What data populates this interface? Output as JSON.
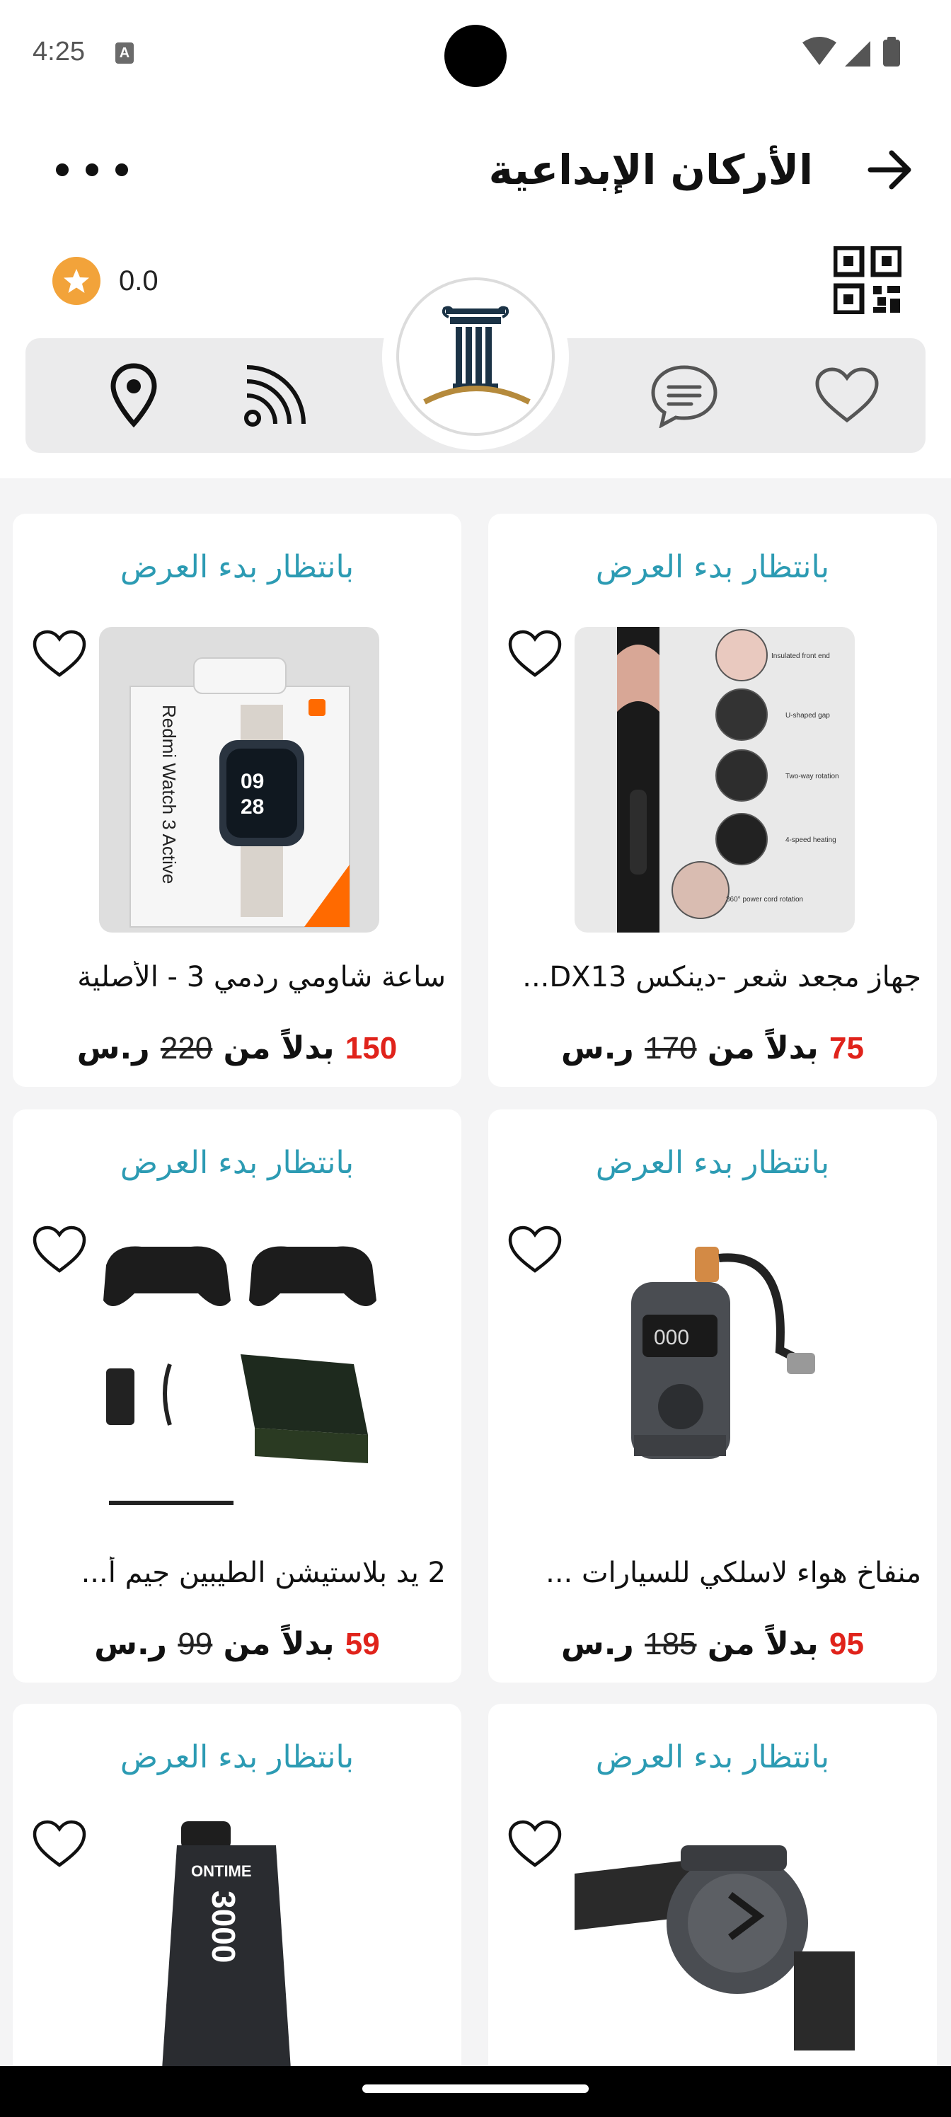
{
  "status": {
    "time": "4:25",
    "notification_badge": "A"
  },
  "header": {
    "title": "الأركان الإبداعية",
    "rating": "0.0"
  },
  "icons": {
    "back": "arrow-right-icon",
    "more": "more-dots-icon",
    "qr": "qr-code-icon",
    "location": "location-pin-icon",
    "rss": "rss-feed-icon",
    "chat": "chat-bubble-icon",
    "favorite": "heart-icon",
    "star": "star-icon"
  },
  "colors": {
    "accent_status": "#2c9bb3",
    "price": "#e0231b",
    "star": "#f2a33a",
    "bar": "#ebebec"
  },
  "products": [
    {
      "status": "بانتظار بدء العرض",
      "title": "جهاز مجعد شعر -دينكس DX13...",
      "price": "75",
      "label": "بدلاً من",
      "old_price": "170",
      "currency": "ر.س"
    },
    {
      "status": "بانتظار بدء العرض",
      "title": "ساعة شاومي ردمي 3 - الأصلية",
      "price": "150",
      "label": "بدلاً من",
      "old_price": "220",
      "currency": "ر.س"
    },
    {
      "status": "بانتظار بدء العرض",
      "title": "منفاخ هواء لاسلكي للسيارات ...",
      "price": "95",
      "label": "بدلاً من",
      "old_price": "185",
      "currency": "ر.س"
    },
    {
      "status": "بانتظار بدء العرض",
      "title": "2 يد بلاستيشن الطيبين جيم أ...",
      "price": "59",
      "label": "بدلاً من",
      "old_price": "99",
      "currency": "ر.س"
    },
    {
      "status": "بانتظار بدء العرض"
    },
    {
      "status": "بانتظار بدء العرض"
    }
  ],
  "product_images": {
    "hair_box_text": [
      "Insulated front end",
      "U-shaped gap",
      "Two-way rotation",
      "4-speed heating",
      "360° power cord rotation"
    ],
    "watch_box_text": "Redmi Watch 3 Active",
    "watch_time": [
      "09",
      "28"
    ],
    "pump_display": "000",
    "powerbank_brand": "ONTIME",
    "powerbank_capacity": "3000"
  }
}
